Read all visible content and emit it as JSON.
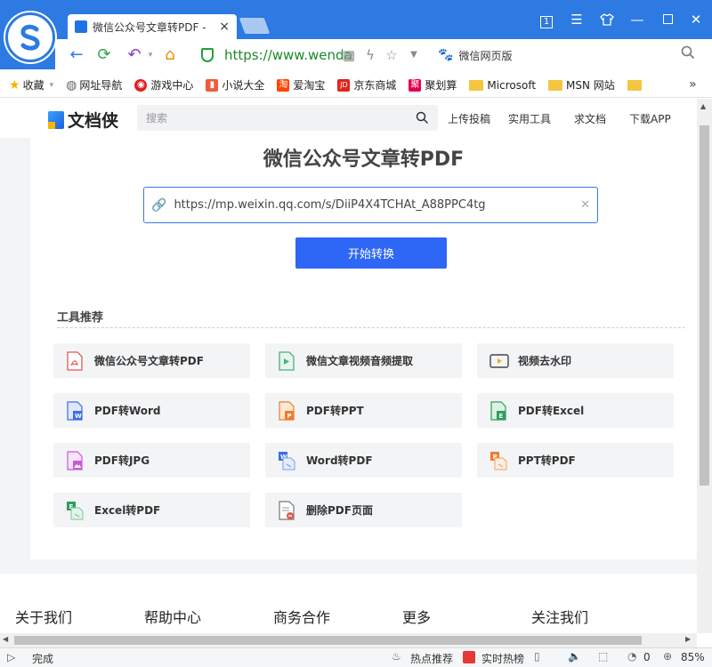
{
  "browser": {
    "tab_title": "微信公众号文章转PDF -",
    "tab_close": "×",
    "window_counter": "1",
    "url": "https://www.wenda",
    "search_engine_label": "微信网页版",
    "bookmarks": [
      {
        "label": "收藏",
        "icon": "star-icon",
        "color": "#f5b400"
      },
      {
        "label": "网址导航",
        "icon": "globe-icon",
        "color": "#666666"
      },
      {
        "label": "游戏中心",
        "icon": "game-icon",
        "color": "#e02020"
      },
      {
        "label": "小说大全",
        "icon": "book-icon",
        "color": "#f05a3a"
      },
      {
        "label": "爱淘宝",
        "icon": "taobao-icon",
        "color": "#ff4400"
      },
      {
        "label": "京东商城",
        "icon": "jd-icon",
        "color": "#e1251b"
      },
      {
        "label": "聚划算",
        "icon": "juhuasuan-icon",
        "color": "#e6004c"
      },
      {
        "label": "Microsoft",
        "icon": "folder-icon",
        "color": "#f5c542"
      },
      {
        "label": "MSN 网站",
        "icon": "folder-icon",
        "color": "#f5c542"
      },
      {
        "label": "",
        "icon": "folder-icon",
        "color": "#f5c542"
      }
    ],
    "bookmark_glyphs": {
      "taobao": "淘",
      "jd": "JD",
      "juhuasuan": "聚"
    },
    "status_text": "完成",
    "status_hot": "热点推荐",
    "status_realtime": "实时热榜",
    "status_count": "0",
    "zoom": "85%"
  },
  "site": {
    "logo_text": "文档侠",
    "search_placeholder": "搜索",
    "nav": [
      "上传投稿",
      "实用工具",
      "求文档",
      "下载APP"
    ],
    "main_title": "微信公众号文章转PDF",
    "input_value": "https://mp.weixin.qq.com/s/DiiP4X4TCHAt_A88PPC4tg",
    "convert_label": "开始转换",
    "tools_heading": "工具推荐",
    "tools": [
      {
        "label": "微信公众号文章转PDF",
        "icon": "pdf-file-icon",
        "color": "#e05a4f"
      },
      {
        "label": "微信文章视频音频提取",
        "icon": "video-file-icon",
        "color": "#4caf7d"
      },
      {
        "label": "视频去水印",
        "icon": "video-watermark-icon",
        "color": "#f5a623"
      },
      {
        "label": "PDF转Word",
        "icon": "word-file-icon",
        "color": "#3b6fe0"
      },
      {
        "label": "PDF转PPT",
        "icon": "ppt-file-icon",
        "color": "#f07b2a"
      },
      {
        "label": "PDF转Excel",
        "icon": "excel-file-icon",
        "color": "#2e9e5b"
      },
      {
        "label": "PDF转JPG",
        "icon": "jpg-file-icon",
        "color": "#c65bd6"
      },
      {
        "label": "Word转PDF",
        "icon": "word-to-pdf-icon",
        "color": "#3b6fe0"
      },
      {
        "label": "PPT转PDF",
        "icon": "ppt-to-pdf-icon",
        "color": "#f07b2a"
      },
      {
        "label": "Excel转PDF",
        "icon": "excel-to-pdf-icon",
        "color": "#2e9e5b"
      },
      {
        "label": "删除PDF页面",
        "icon": "delete-pdf-page-icon",
        "color": "#e05a4f"
      }
    ],
    "footer": [
      "关于我们",
      "帮助中心",
      "商务合作",
      "更多",
      "关注我们"
    ]
  },
  "colors": {
    "accent": "#2e66f5",
    "chrome_blue": "#2c7ae2"
  }
}
